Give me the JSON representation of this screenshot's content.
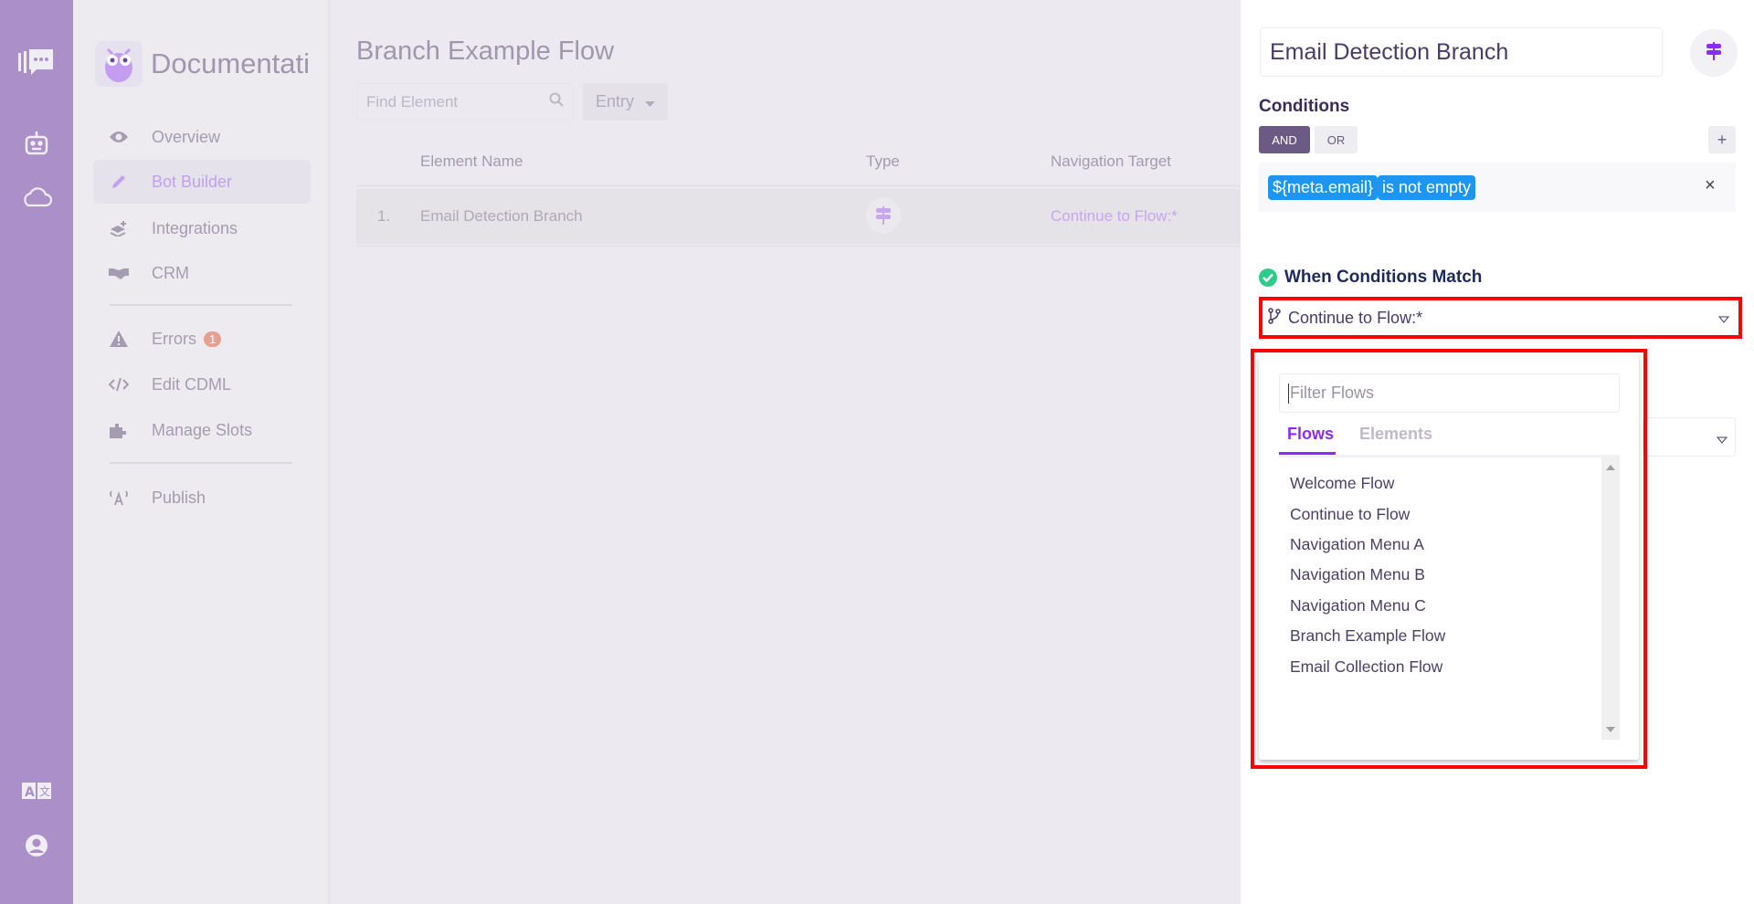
{
  "rail": {
    "icons": [
      "chat-logo-icon",
      "robot-icon",
      "cloud-icon",
      "translate-icon",
      "user-account-icon"
    ]
  },
  "sidebar": {
    "brand": "Documentation",
    "items": [
      {
        "label": "Overview",
        "icon": "eye-icon"
      },
      {
        "label": "Bot Builder",
        "icon": "pencil-icon",
        "active": true
      },
      {
        "label": "Integrations",
        "icon": "layers-plus-icon"
      },
      {
        "label": "CRM",
        "icon": "handshake-icon"
      },
      {
        "label": "Errors",
        "icon": "warning-icon",
        "badge": "1"
      },
      {
        "label": "Edit CDML",
        "icon": "code-icon"
      },
      {
        "label": "Manage Slots",
        "icon": "puzzle-icon"
      },
      {
        "label": "Publish",
        "icon": "broadcast-icon"
      }
    ]
  },
  "main": {
    "title": "Branch Example Flow",
    "search_placeholder": "Find Element",
    "filter_value": "Entry",
    "columns": [
      "Element Name",
      "Type",
      "Navigation Target"
    ],
    "rows": [
      {
        "index": "1.",
        "name": "Email Detection Branch",
        "type_icon": "signpost-icon",
        "target": "Continue to Flow:*"
      }
    ]
  },
  "panel": {
    "element_name": "Email Detection Branch",
    "conditions_label": "Conditions",
    "and_label": "AND",
    "or_label": "OR",
    "add_label": "+",
    "condition": {
      "variable": "${meta.email}",
      "operator": "is not empty",
      "remove": "×"
    },
    "match_label": "When Conditions Match",
    "match_select": "Continue to Flow:*",
    "dropdown": {
      "filter_placeholder": "Filter Flows",
      "tabs": [
        "Flows",
        "Elements"
      ],
      "active_tab": "Flows",
      "items": [
        "Welcome Flow",
        "Continue to Flow",
        "Navigation Menu A",
        "Navigation Menu B",
        "Navigation Menu C",
        "Branch Example Flow",
        "Email Collection Flow"
      ]
    }
  },
  "colors": {
    "accent": "#8b2cf5",
    "tag": "#1f95f2",
    "highlight": "#ff0000",
    "success": "#2ecc8a"
  }
}
